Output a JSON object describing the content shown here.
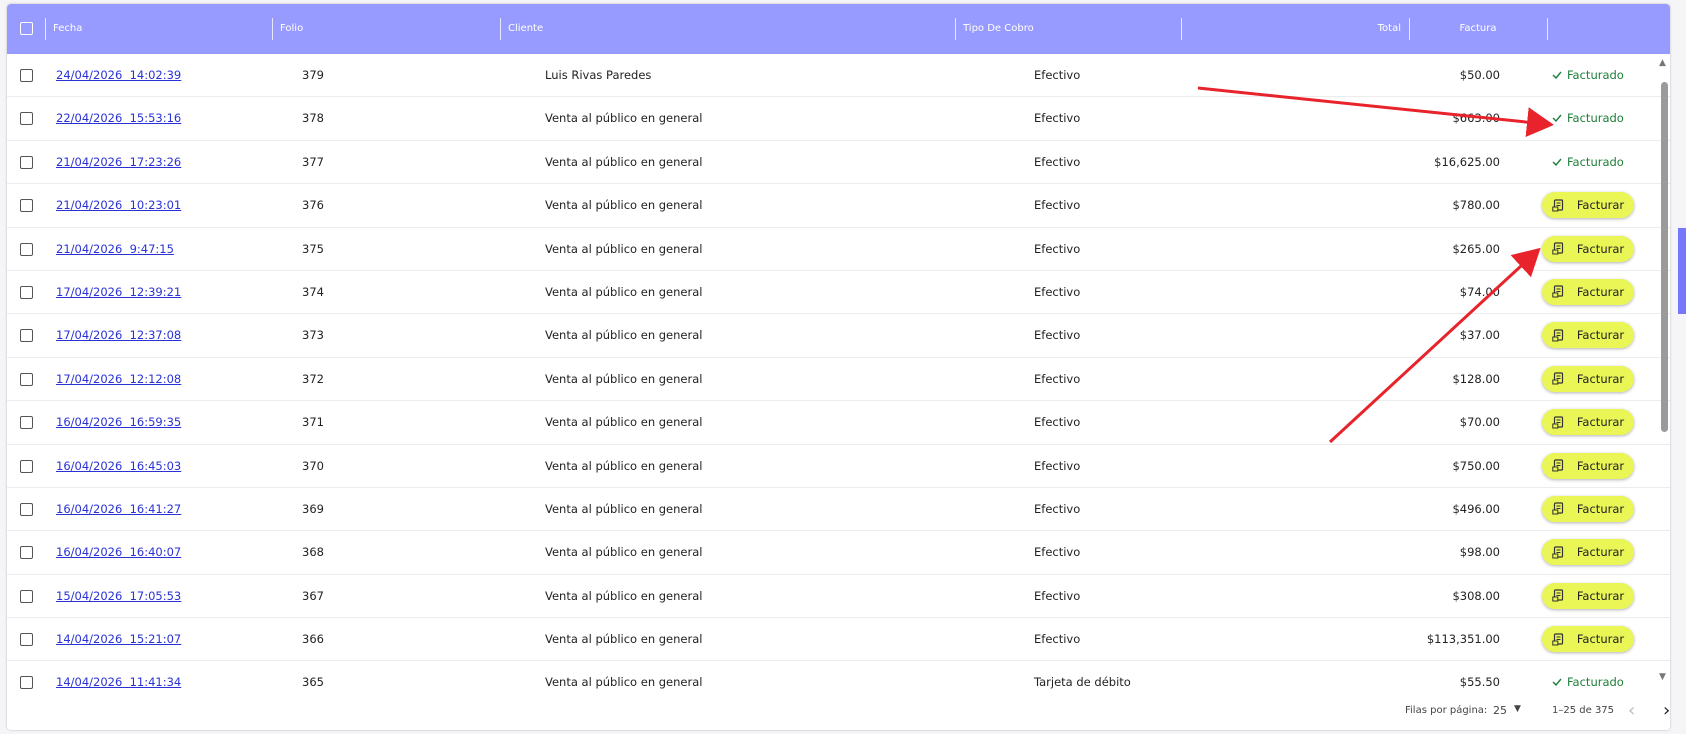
{
  "header": {
    "fecha": "Fecha",
    "folio": "Folio",
    "cliente": "Cliente",
    "tipo": "Tipo De Cobro",
    "total": "Total",
    "factura": "Factura"
  },
  "labels": {
    "facturado": "Facturado",
    "facturar": "Facturar"
  },
  "rows": [
    {
      "fecha": "24/04/2026  14:02:39",
      "folio": "379",
      "cliente": "Luis Rivas Paredes",
      "tipo": "Efectivo",
      "total": "$50.00",
      "factura": "facturado"
    },
    {
      "fecha": "22/04/2026  15:53:16",
      "folio": "378",
      "cliente": "Venta al público en general",
      "tipo": "Efectivo",
      "total": "$663.00",
      "factura": "facturado"
    },
    {
      "fecha": "21/04/2026  17:23:26",
      "folio": "377",
      "cliente": "Venta al público en general",
      "tipo": "Efectivo",
      "total": "$16,625.00",
      "factura": "facturado"
    },
    {
      "fecha": "21/04/2026  10:23:01",
      "folio": "376",
      "cliente": "Venta al público en general",
      "tipo": "Efectivo",
      "total": "$780.00",
      "factura": "facturar"
    },
    {
      "fecha": "21/04/2026  9:47:15",
      "folio": "375",
      "cliente": "Venta al público en general",
      "tipo": "Efectivo",
      "total": "$265.00",
      "factura": "facturar"
    },
    {
      "fecha": "17/04/2026  12:39:21",
      "folio": "374",
      "cliente": "Venta al público en general",
      "tipo": "Efectivo",
      "total": "$74.00",
      "factura": "facturar"
    },
    {
      "fecha": "17/04/2026  12:37:08",
      "folio": "373",
      "cliente": "Venta al público en general",
      "tipo": "Efectivo",
      "total": "$37.00",
      "factura": "facturar"
    },
    {
      "fecha": "17/04/2026  12:12:08",
      "folio": "372",
      "cliente": "Venta al público en general",
      "tipo": "Efectivo",
      "total": "$128.00",
      "factura": "facturar"
    },
    {
      "fecha": "16/04/2026  16:59:35",
      "folio": "371",
      "cliente": "Venta al público en general",
      "tipo": "Efectivo",
      "total": "$70.00",
      "factura": "facturar"
    },
    {
      "fecha": "16/04/2026  16:45:03",
      "folio": "370",
      "cliente": "Venta al público en general",
      "tipo": "Efectivo",
      "total": "$750.00",
      "factura": "facturar"
    },
    {
      "fecha": "16/04/2026  16:41:27",
      "folio": "369",
      "cliente": "Venta al público en general",
      "tipo": "Efectivo",
      "total": "$496.00",
      "factura": "facturar"
    },
    {
      "fecha": "16/04/2026  16:40:07",
      "folio": "368",
      "cliente": "Venta al público en general",
      "tipo": "Efectivo",
      "total": "$98.00",
      "factura": "facturar"
    },
    {
      "fecha": "15/04/2026  17:05:53",
      "folio": "367",
      "cliente": "Venta al público en general",
      "tipo": "Efectivo",
      "total": "$308.00",
      "factura": "facturar"
    },
    {
      "fecha": "14/04/2026  15:21:07",
      "folio": "366",
      "cliente": "Venta al público en general",
      "tipo": "Efectivo",
      "total": "$113,351.00",
      "factura": "facturar"
    },
    {
      "fecha": "14/04/2026  11:41:34",
      "folio": "365",
      "cliente": "Venta al público en general",
      "tipo": "Tarjeta de débito",
      "total": "$55.50",
      "factura": "facturado"
    }
  ],
  "footer": {
    "rows_per_page_label": "Filas por página:",
    "rows_per_page": "25",
    "range": "1–25 de 375"
  },
  "colors": {
    "header_bg": "#979bff",
    "link": "#2a32d6",
    "facturado": "#1e7e3a",
    "facturar_bg": "#eaf556",
    "annotation_arrow": "#e8232b"
  },
  "icons": {
    "facturado": "check-icon",
    "facturar": "invoice-icon",
    "prev": "chevron-left-icon",
    "next": "chevron-right-icon"
  }
}
